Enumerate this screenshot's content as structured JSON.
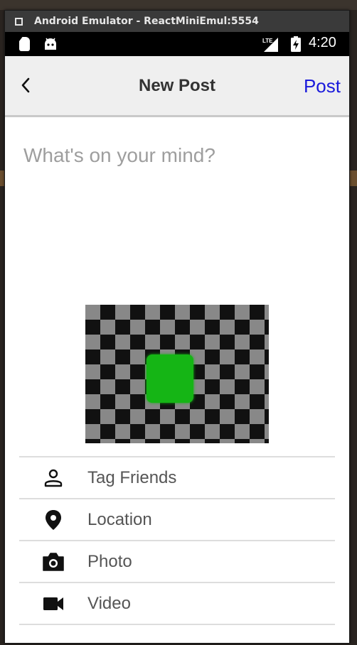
{
  "window": {
    "title": "Android Emulator - ReactMiniEmul:5554"
  },
  "status_bar": {
    "time": "4:20",
    "network": "LTE"
  },
  "app_bar": {
    "back_icon": "chevron-left-icon",
    "title": "New Post",
    "post_label": "Post",
    "post_color": "#1a1adb"
  },
  "composer": {
    "placeholder": "What's on your mind?",
    "value": ""
  },
  "attachment": {
    "description_icon": "image-thumbnail"
  },
  "options": [
    {
      "label": "Tag Friends",
      "icon": "person-icon"
    },
    {
      "label": "Location",
      "icon": "location-pin-icon"
    },
    {
      "label": "Photo",
      "icon": "camera-icon"
    },
    {
      "label": "Video",
      "icon": "video-camera-icon"
    }
  ]
}
